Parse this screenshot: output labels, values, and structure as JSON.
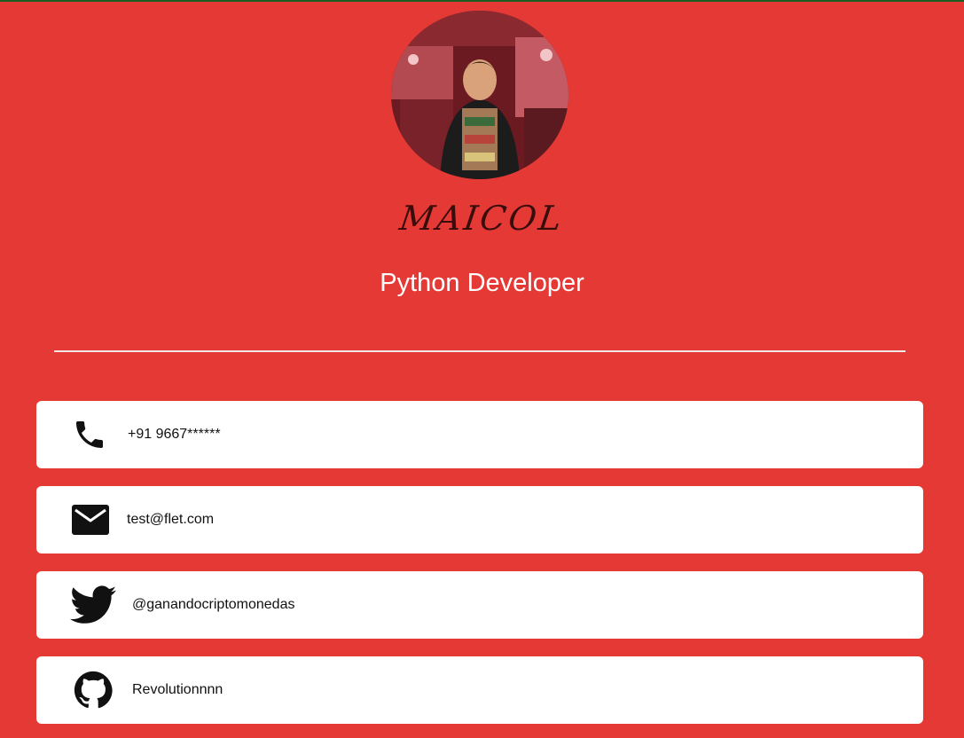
{
  "profile": {
    "name": "MAICOL",
    "role": "Python Developer"
  },
  "contacts": [
    {
      "icon": "phone-icon",
      "text": "+91 9667******"
    },
    {
      "icon": "mail-icon",
      "text": "test@flet.com"
    },
    {
      "icon": "twitter-icon",
      "text": "@ganandocriptomonedas"
    },
    {
      "icon": "github-icon",
      "text": "Revolutionnnn"
    }
  ],
  "colors": {
    "background": "#e53935",
    "card": "#ffffff",
    "role_text": "#ffffff",
    "name_text": "#3a0d0d",
    "divider": "#f3e8e8",
    "top_strip": "#1b5e20"
  }
}
